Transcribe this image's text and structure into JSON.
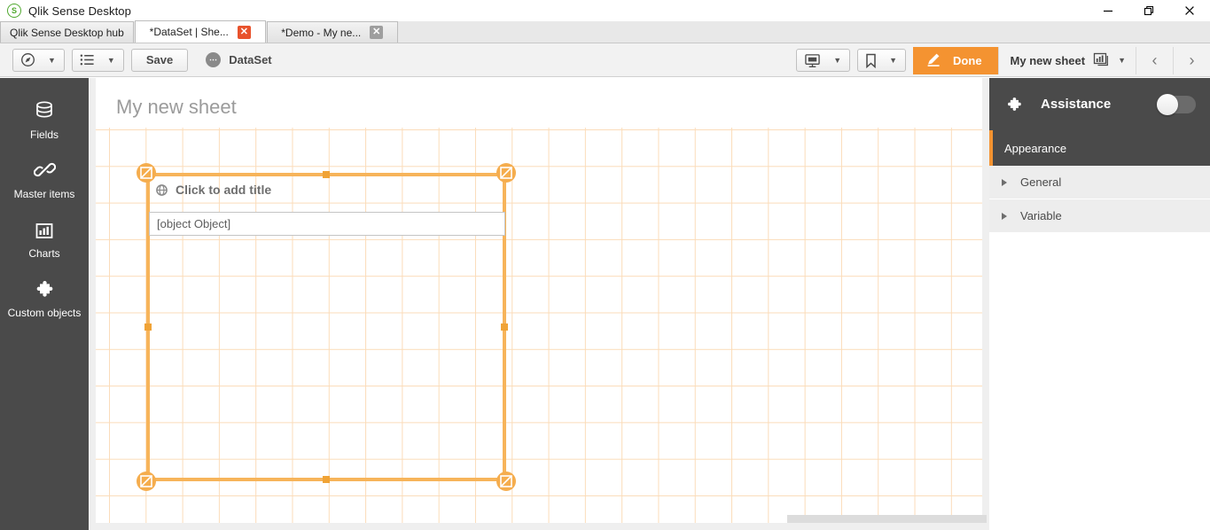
{
  "window": {
    "title": "Qlik Sense Desktop",
    "logo_icon": "qlik-s-logo-icon",
    "minimize_icon": "minimize-icon",
    "maximize_icon": "maximize-icon",
    "close_icon": "close-icon"
  },
  "tabs": [
    {
      "label": "Qlik Sense Desktop hub",
      "active": false,
      "closable": false
    },
    {
      "label": "*DataSet | She...",
      "active": true,
      "closable": true,
      "close_label": "✕"
    },
    {
      "label": "*Demo - My ne...",
      "active": false,
      "closable": true,
      "close_label": "✕"
    }
  ],
  "toolbar": {
    "nav_icon": "compass-icon",
    "nav_caret": "▼",
    "sheets_icon": "list-icon",
    "sheets_caret": "▼",
    "save_label": "Save",
    "dataset_label": "DataSet",
    "dataset_icon": "data-bubble-icon",
    "storytelling_icon": "presentation-icon",
    "storytelling_caret": "▼",
    "bookmark_icon": "bookmark-icon",
    "bookmark_caret": "▼",
    "edit_icon": "pencil-icon",
    "done_label": "Done",
    "sheet_name": "My new sheet",
    "sheet_icon": "chart-bars-icon",
    "sheet_caret": "▼",
    "prev_label": "‹",
    "next_label": "›"
  },
  "sidebar": {
    "items": [
      {
        "label": "Fields",
        "icon": "database-icon"
      },
      {
        "label": "Master items",
        "icon": "link-chain-icon"
      },
      {
        "label": "Charts",
        "icon": "bar-chart-icon"
      },
      {
        "label": "Custom objects",
        "icon": "puzzle-piece-icon"
      }
    ]
  },
  "canvas": {
    "sheet_title": "My new sheet",
    "selected_object": {
      "title_placeholder": "Click to add title",
      "title_icon": "extension-object-icon",
      "field_value": "[object Object]",
      "handle_icon": "resize-handle-icon"
    }
  },
  "right_panel": {
    "header": {
      "title": "Assistance",
      "icon": "puzzle-piece-icon",
      "toggle_on": false
    },
    "section_title": "Appearance",
    "rows": [
      {
        "label": "General"
      },
      {
        "label": "Variable"
      }
    ]
  },
  "colors": {
    "accent_orange": "#f49331",
    "handle_orange": "#f5ad4e",
    "grid_orange": "#fbdcb9",
    "panel_dark": "#4a4a4a",
    "toolbar_bg": "#f2f2f2"
  }
}
